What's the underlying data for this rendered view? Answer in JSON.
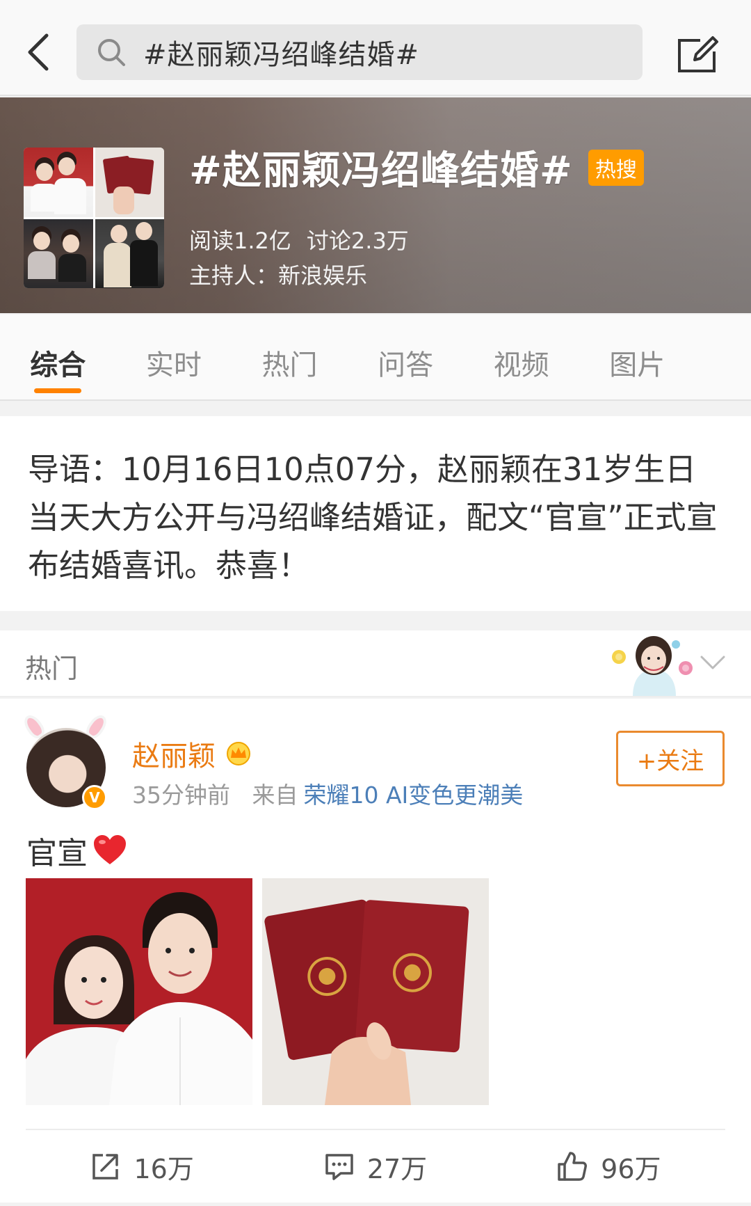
{
  "search": {
    "query": "#赵丽颖冯绍峰结婚#"
  },
  "topic": {
    "title": "#赵丽颖冯绍峰结婚#",
    "badge": "热搜",
    "reads": "阅读1.2亿",
    "discussions": "讨论2.3万",
    "host": "主持人：新浪娱乐"
  },
  "tabs": [
    {
      "label": "综合",
      "active": true
    },
    {
      "label": "实时"
    },
    {
      "label": "热门"
    },
    {
      "label": "问答"
    },
    {
      "label": "视频"
    },
    {
      "label": "图片"
    }
  ],
  "intro": {
    "text": "导语：10月16日10点07分，赵丽颖在31岁生日当天大方公开与冯绍峰结婚证，配文“官宣”正式宣布结婚喜讯。恭喜！"
  },
  "hot_section": {
    "label": "热门"
  },
  "post": {
    "author": "赵丽颖",
    "time": "35分钟前",
    "source_prefix": "来自",
    "source": "荣耀10 AI变色更潮美",
    "follow_label": "+关注",
    "text": "官宣",
    "verified_mark": "V",
    "actions": {
      "repost": "16万",
      "comment": "27万",
      "like": "96万"
    }
  },
  "colors": {
    "accent": "#ff8200",
    "author": "#ea7b13",
    "link": "#4c7fb8",
    "badge": "#ff9c00"
  }
}
